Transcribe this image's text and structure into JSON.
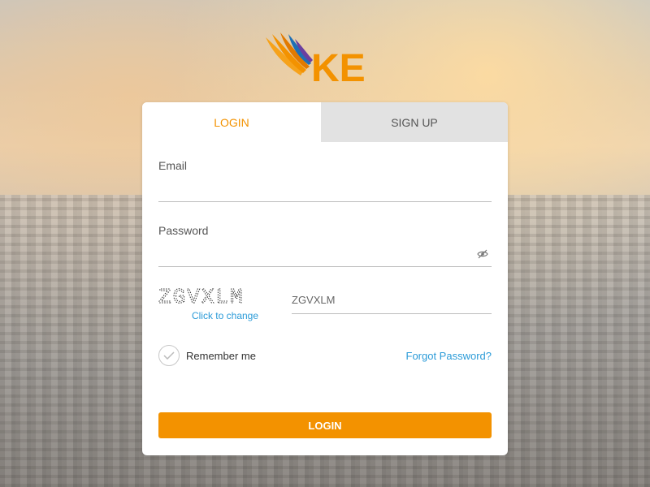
{
  "brand": {
    "logo_text": "KE",
    "accent": "#f39200",
    "link_color": "#2b9bd8"
  },
  "tabs": {
    "login_label": "LOGIN",
    "signup_label": "SIGN UP"
  },
  "form": {
    "email": {
      "label": "Email",
      "value": ""
    },
    "password": {
      "label": "Password",
      "value": "",
      "toggle_icon": "eye-slash-icon"
    },
    "captcha": {
      "code": "ZGVXLM",
      "change_label": "Click to change",
      "input_value": "ZGVXLM"
    },
    "remember_label": "Remember me",
    "forgot_label": "Forgot Password?",
    "submit_label": "LOGIN"
  }
}
